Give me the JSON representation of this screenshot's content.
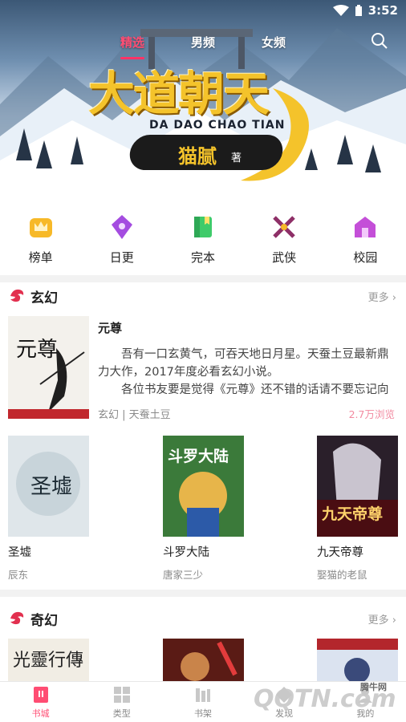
{
  "status": {
    "time": "3:52"
  },
  "top_tabs": [
    {
      "label": "精选",
      "active": true
    },
    {
      "label": "男频",
      "active": false
    },
    {
      "label": "女频",
      "active": false
    }
  ],
  "banner": {
    "title": "大道朝天",
    "pinyin": "DA DAO CHAO TIAN",
    "author": "猫腻",
    "author_suffix": "著"
  },
  "categories": [
    {
      "label": "榜单",
      "icon": "crown-icon",
      "color": "#f7b928"
    },
    {
      "label": "日更",
      "icon": "pen-icon",
      "color": "#a44ce0"
    },
    {
      "label": "完本",
      "icon": "book-icon",
      "color": "#3fcb6a"
    },
    {
      "label": "武侠",
      "icon": "crossed-swords-icon",
      "color": "#8e2f67"
    },
    {
      "label": "校园",
      "icon": "school-icon",
      "color": "#c44fd8"
    }
  ],
  "section_xuanhuan": {
    "title": "玄幻",
    "more": "更多",
    "featured": {
      "title": "元尊",
      "description": "吾有一口玄黄气，可吞天地日月星。天蚕土豆最新鼎力大作，2017年度必看玄幻小说。\n各位书友要是觉得《元尊》还不错的话请不要忘记向",
      "desc_line1": "吾有一口玄黄气，可吞天地日月星。天蚕土豆最新鼎",
      "desc_line2": "力大作，2017年度必看玄幻小说。",
      "desc_line3": "各位书友要是觉得《元尊》还不错的话请不要忘记向",
      "meta": "玄幻 | 天蚕土豆",
      "views": "2.7万浏览",
      "cover_text": "元尊"
    },
    "books": [
      {
        "title": "圣墟",
        "author": "辰东",
        "cover_text": "圣墟"
      },
      {
        "title": "斗罗大陆",
        "author": "唐家三少",
        "cover_text": "斗罗大陆"
      },
      {
        "title": "九天帝尊",
        "author": "娶猫的老鼠",
        "cover_text": "九天帝尊"
      }
    ]
  },
  "section_qihuan": {
    "title": "奇幻",
    "more": "更多",
    "partial_covers": [
      "光靈行傳",
      "",
      ""
    ]
  },
  "bottom_nav": [
    {
      "label": "书城",
      "icon": "bookstore-icon",
      "active": true
    },
    {
      "label": "类型",
      "icon": "grid-icon",
      "active": false
    },
    {
      "label": "书架",
      "icon": "bookshelf-icon",
      "active": false
    },
    {
      "label": "发现",
      "icon": "discover-icon",
      "active": false
    },
    {
      "label": "我的",
      "icon": "profile-icon",
      "active": false
    }
  ],
  "watermark": {
    "text": "QQTN.com",
    "sub": "腾牛网"
  },
  "colors": {
    "accent": "#ff4d73",
    "banner_gold": "#f4c32b"
  }
}
